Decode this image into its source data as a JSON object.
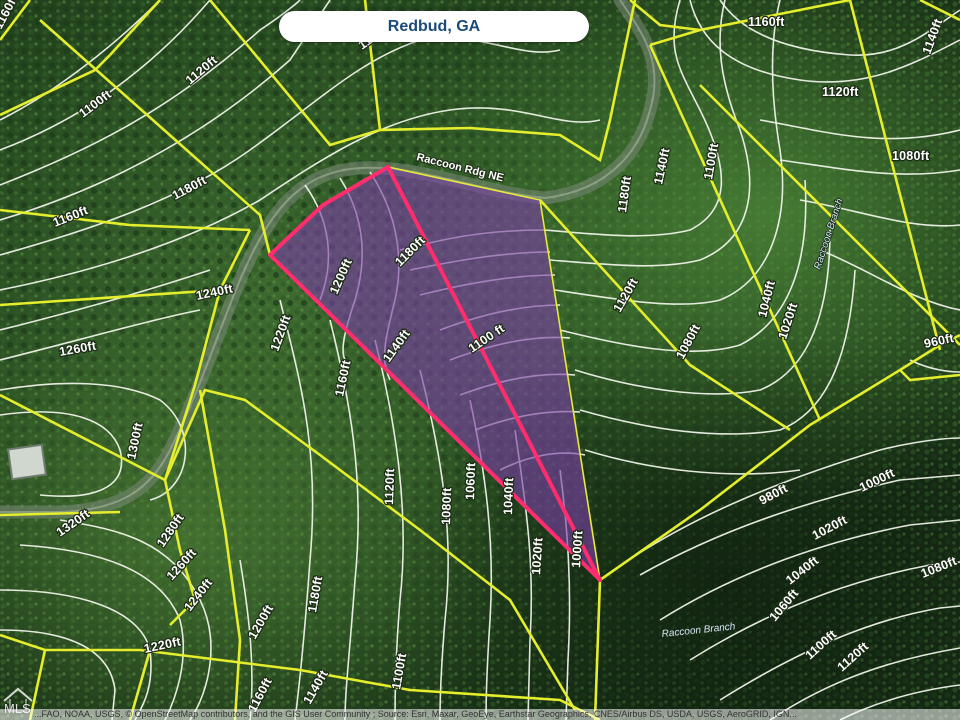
{
  "map": {
    "title": "Redbud, GA",
    "road_label": "Raccoon Rdg NE",
    "water_labels": [
      "Raccoon Branch",
      "Raccoon Branch"
    ],
    "logo_text": "MLS",
    "attribution": "...FAO, NOAA, USGS, © OpenStreetMap contributors, and the GIS User Community ; Source: Esri, Maxar, GeoEye, Earthstar Geographics, CNES/Airbus DS, USDA, USGS, AeroGRID, IGN...",
    "colors": {
      "lot_fill": "#7b3fa6",
      "lot_boundary": "#ff2d6e",
      "parcel_lines": "#e4ee2c",
      "contours": "#ffffff",
      "title_text": "#1a4a7a"
    },
    "contour_labels": [
      "1160ft",
      "1120ft",
      "1100ft",
      "1160ft",
      "1180ft",
      "1120ft",
      "1160ft",
      "1140ft",
      "1140ft",
      "1120ft",
      "1080ft",
      "1160ft",
      "1140ft",
      "1100ft",
      "1180ft",
      "1200ft",
      "1180ft",
      "1240ft",
      "1260ft",
      "1220ft",
      "1140ft",
      "1100 ft",
      "1160ft",
      "1120ft",
      "1120ft",
      "1080ft",
      "1040ft",
      "1020ft",
      "1080ft",
      "960ft",
      "1300ft",
      "1320ft",
      "1280ft",
      "1260ft",
      "1240ft",
      "1200ft",
      "1180ft",
      "1120ft",
      "1080ft",
      "1060ft",
      "1040ft",
      "1020ft",
      "1000ft",
      "980ft",
      "1000ft",
      "1020ft",
      "1040ft",
      "1060ft",
      "1080ft",
      "1100ft",
      "1120ft",
      "1220ft",
      "1160ft",
      "1140ft",
      "1100ft"
    ]
  }
}
